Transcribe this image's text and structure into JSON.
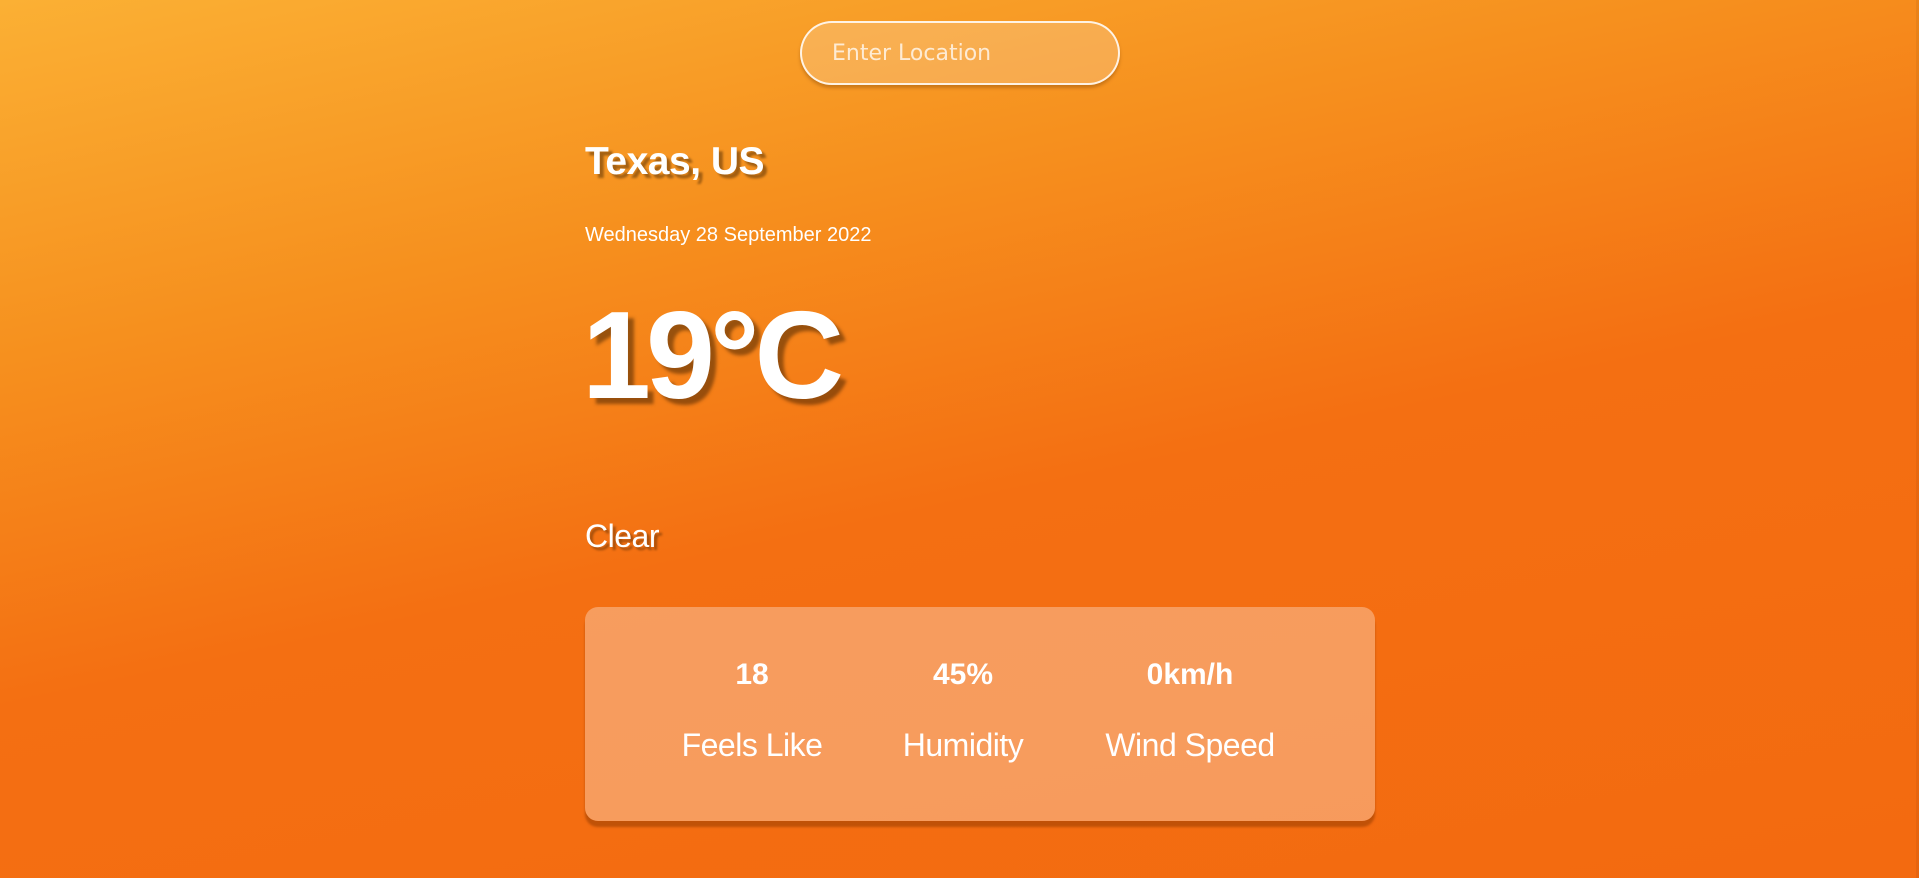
{
  "search": {
    "placeholder": "Enter Location",
    "value": ""
  },
  "weather": {
    "location": "Texas, US",
    "date": "Wednesday 28 September 2022",
    "temperature": "19°C",
    "condition": "Clear"
  },
  "stats": [
    {
      "value": "18",
      "label": "Feels Like"
    },
    {
      "value": "45%",
      "label": "Humidity"
    },
    {
      "value": "0km/h",
      "label": "Wind Speed"
    }
  ],
  "colors": {
    "gradient_top": "#fbb034",
    "gradient_bottom": "#f36a10",
    "text": "#ffffff"
  }
}
